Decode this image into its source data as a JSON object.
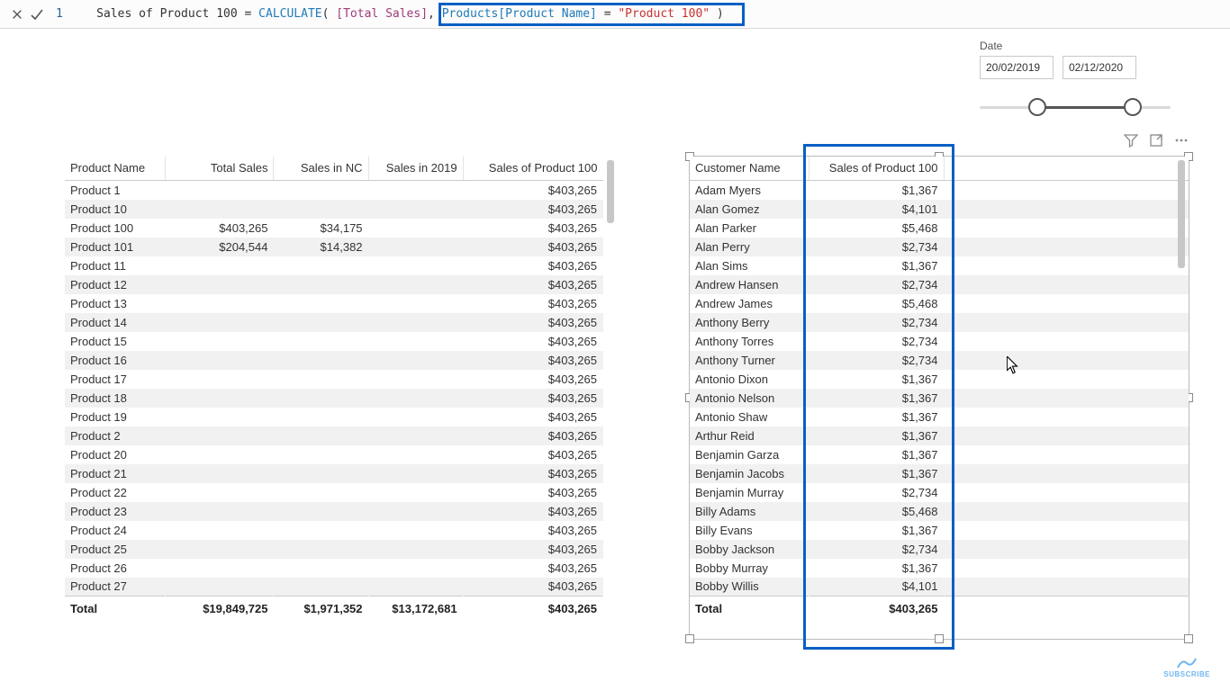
{
  "formula": {
    "line": "1",
    "measure_name": "Sales of Product 100",
    "equals": " = ",
    "func": "CALCULATE",
    "open": "( ",
    "measure_ref": "[Total Sales]",
    "comma": ", ",
    "col_ref": "Products[Product Name]",
    "compare": " = ",
    "string": "\"Product 100\"",
    "close": " )"
  },
  "date_slicer": {
    "title": "Date",
    "from": "20/02/2019",
    "to": "02/12/2020"
  },
  "table_products": {
    "headers": [
      "Product Name",
      "Total Sales",
      "Sales in NC",
      "Sales in 2019",
      "Sales of Product 100"
    ],
    "rows": [
      {
        "name": "Product 1",
        "total": "",
        "nc": "",
        "y2019": "",
        "p100": "$403,265"
      },
      {
        "name": "Product 10",
        "total": "",
        "nc": "",
        "y2019": "",
        "p100": "$403,265"
      },
      {
        "name": "Product 100",
        "total": "$403,265",
        "nc": "$34,175",
        "y2019": "",
        "p100": "$403,265"
      },
      {
        "name": "Product 101",
        "total": "$204,544",
        "nc": "$14,382",
        "y2019": "",
        "p100": "$403,265"
      },
      {
        "name": "Product 11",
        "total": "",
        "nc": "",
        "y2019": "",
        "p100": "$403,265"
      },
      {
        "name": "Product 12",
        "total": "",
        "nc": "",
        "y2019": "",
        "p100": "$403,265"
      },
      {
        "name": "Product 13",
        "total": "",
        "nc": "",
        "y2019": "",
        "p100": "$403,265"
      },
      {
        "name": "Product 14",
        "total": "",
        "nc": "",
        "y2019": "",
        "p100": "$403,265"
      },
      {
        "name": "Product 15",
        "total": "",
        "nc": "",
        "y2019": "",
        "p100": "$403,265"
      },
      {
        "name": "Product 16",
        "total": "",
        "nc": "",
        "y2019": "",
        "p100": "$403,265"
      },
      {
        "name": "Product 17",
        "total": "",
        "nc": "",
        "y2019": "",
        "p100": "$403,265"
      },
      {
        "name": "Product 18",
        "total": "",
        "nc": "",
        "y2019": "",
        "p100": "$403,265"
      },
      {
        "name": "Product 19",
        "total": "",
        "nc": "",
        "y2019": "",
        "p100": "$403,265"
      },
      {
        "name": "Product 2",
        "total": "",
        "nc": "",
        "y2019": "",
        "p100": "$403,265"
      },
      {
        "name": "Product 20",
        "total": "",
        "nc": "",
        "y2019": "",
        "p100": "$403,265"
      },
      {
        "name": "Product 21",
        "total": "",
        "nc": "",
        "y2019": "",
        "p100": "$403,265"
      },
      {
        "name": "Product 22",
        "total": "",
        "nc": "",
        "y2019": "",
        "p100": "$403,265"
      },
      {
        "name": "Product 23",
        "total": "",
        "nc": "",
        "y2019": "",
        "p100": "$403,265"
      },
      {
        "name": "Product 24",
        "total": "",
        "nc": "",
        "y2019": "",
        "p100": "$403,265"
      },
      {
        "name": "Product 25",
        "total": "",
        "nc": "",
        "y2019": "",
        "p100": "$403,265"
      },
      {
        "name": "Product 26",
        "total": "",
        "nc": "",
        "y2019": "",
        "p100": "$403,265"
      },
      {
        "name": "Product 27",
        "total": "",
        "nc": "",
        "y2019": "",
        "p100": "$403,265"
      }
    ],
    "footer": {
      "label": "Total",
      "total": "$19,849,725",
      "nc": "$1,971,352",
      "y2019": "$13,172,681",
      "p100": "$403,265"
    }
  },
  "table_customers": {
    "headers": [
      "Customer Name",
      "Sales of Product 100"
    ],
    "rows": [
      {
        "name": "Adam Myers",
        "val": "$1,367"
      },
      {
        "name": "Alan Gomez",
        "val": "$4,101"
      },
      {
        "name": "Alan Parker",
        "val": "$5,468"
      },
      {
        "name": "Alan Perry",
        "val": "$2,734"
      },
      {
        "name": "Alan Sims",
        "val": "$1,367"
      },
      {
        "name": "Andrew Hansen",
        "val": "$2,734"
      },
      {
        "name": "Andrew James",
        "val": "$5,468"
      },
      {
        "name": "Anthony Berry",
        "val": "$2,734"
      },
      {
        "name": "Anthony Torres",
        "val": "$2,734"
      },
      {
        "name": "Anthony Turner",
        "val": "$2,734"
      },
      {
        "name": "Antonio Dixon",
        "val": "$1,367"
      },
      {
        "name": "Antonio Nelson",
        "val": "$1,367"
      },
      {
        "name": "Antonio Shaw",
        "val": "$1,367"
      },
      {
        "name": "Arthur Reid",
        "val": "$1,367"
      },
      {
        "name": "Benjamin Garza",
        "val": "$1,367"
      },
      {
        "name": "Benjamin Jacobs",
        "val": "$1,367"
      },
      {
        "name": "Benjamin Murray",
        "val": "$2,734"
      },
      {
        "name": "Billy Adams",
        "val": "$5,468"
      },
      {
        "name": "Billy Evans",
        "val": "$1,367"
      },
      {
        "name": "Bobby Jackson",
        "val": "$2,734"
      },
      {
        "name": "Bobby Murray",
        "val": "$1,367"
      },
      {
        "name": "Bobby Willis",
        "val": "$4,101"
      }
    ],
    "footer": {
      "label": "Total",
      "val": "$403,265"
    }
  },
  "subscribe_label": "SUBSCRIBE"
}
